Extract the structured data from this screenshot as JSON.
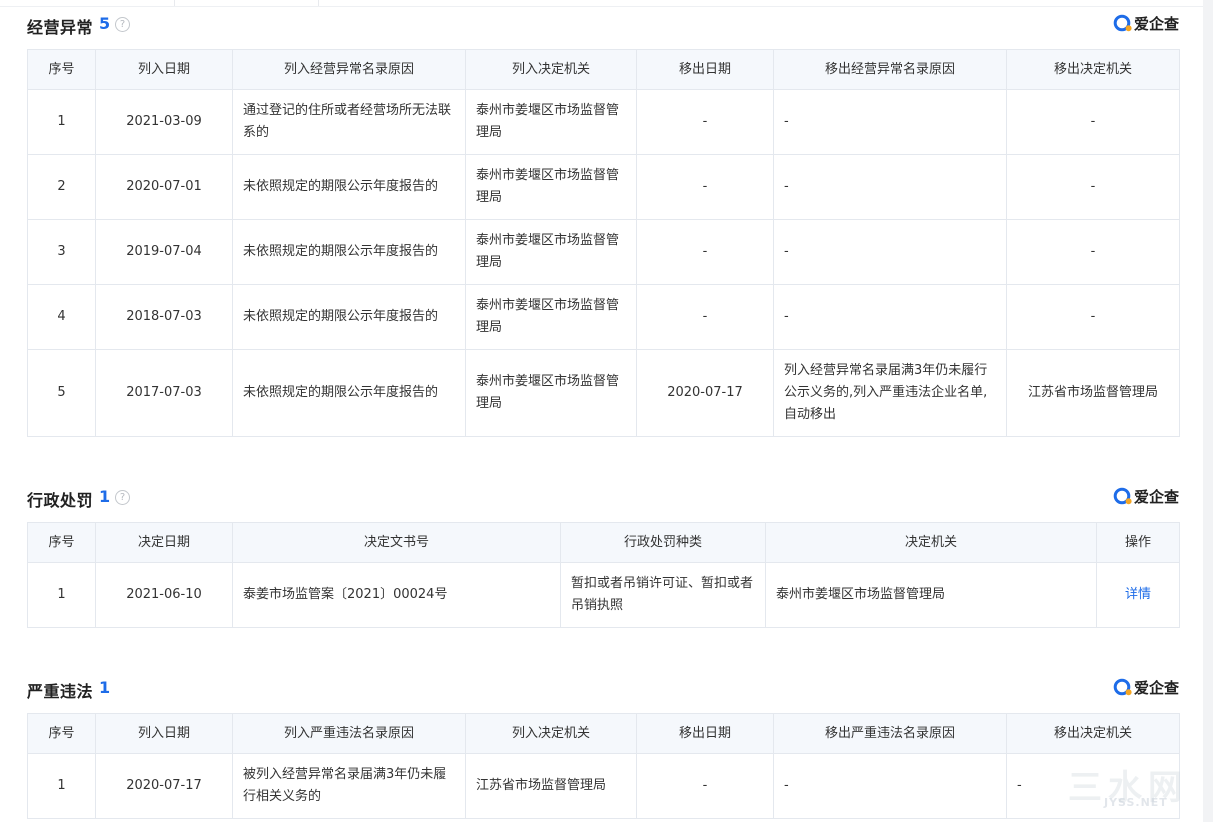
{
  "brand": {
    "name": "爱企查",
    "icon": "aiqicha-logo-icon",
    "ring_color": "#1e6ce8",
    "dot_color": "#f5a623"
  },
  "abnormal": {
    "title": "经营异常",
    "count": "5",
    "help": "?",
    "headers": [
      "序号",
      "列入日期",
      "列入经营异常名录原因",
      "列入决定机关",
      "移出日期",
      "移出经营异常名录原因",
      "移出决定机关"
    ],
    "rows": [
      [
        "1",
        "2021-03-09",
        "通过登记的住所或者经营场所无法联系的",
        "泰州市姜堰区市场监督管理局",
        "-",
        "-",
        "-"
      ],
      [
        "2",
        "2020-07-01",
        "未依照规定的期限公示年度报告的",
        "泰州市姜堰区市场监督管理局",
        "-",
        "-",
        "-"
      ],
      [
        "3",
        "2019-07-04",
        "未依照规定的期限公示年度报告的",
        "泰州市姜堰区市场监督管理局",
        "-",
        "-",
        "-"
      ],
      [
        "4",
        "2018-07-03",
        "未依照规定的期限公示年度报告的",
        "泰州市姜堰区市场监督管理局",
        "-",
        "-",
        "-"
      ],
      [
        "5",
        "2017-07-03",
        "未依照规定的期限公示年度报告的",
        "泰州市姜堰区市场监督管理局",
        "2020-07-17",
        "列入经营异常名录届满3年仍未履行公示义务的,列入严重违法企业名单,自动移出",
        "江苏省市场监督管理局"
      ]
    ]
  },
  "penalty": {
    "title": "行政处罚",
    "count": "1",
    "help": "?",
    "headers": [
      "序号",
      "决定日期",
      "决定文书号",
      "行政处罚种类",
      "决定机关",
      "操作"
    ],
    "rows": [
      [
        "1",
        "2021-06-10",
        "泰姜市场监管案〔2021〕00024号",
        "暂扣或者吊销许可证、暂扣或者吊销执照",
        "泰州市姜堰区市场监督管理局",
        "详情"
      ]
    ]
  },
  "serious": {
    "title": "严重违法",
    "count": "1",
    "headers": [
      "序号",
      "列入日期",
      "列入严重违法名录原因",
      "列入决定机关",
      "移出日期",
      "移出严重违法名录原因",
      "移出决定机关"
    ],
    "rows": [
      [
        "1",
        "2020-07-17",
        "被列入经营异常名录届满3年仍未履行相关义务的",
        "江苏省市场监督管理局",
        "-",
        "-",
        "-"
      ]
    ]
  },
  "watermark": {
    "cn": "三水网",
    "en": "JYSS.NET"
  }
}
